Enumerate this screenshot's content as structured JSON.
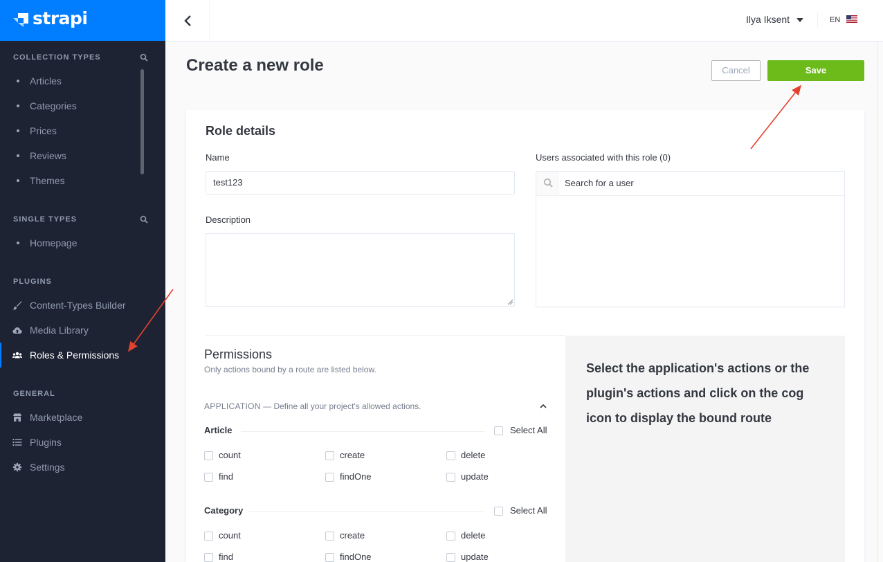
{
  "brand": {
    "name": "strapi"
  },
  "sidebar": {
    "collection_types": {
      "title": "COLLECTION TYPES",
      "items": [
        {
          "label": "Articles"
        },
        {
          "label": "Categories"
        },
        {
          "label": "Prices"
        },
        {
          "label": "Reviews"
        },
        {
          "label": "Themes"
        }
      ]
    },
    "single_types": {
      "title": "SINGLE TYPES",
      "items": [
        {
          "label": "Homepage"
        }
      ]
    },
    "plugins": {
      "title": "PLUGINS",
      "items": [
        {
          "label": "Content-Types Builder",
          "icon": "paintbrush-icon"
        },
        {
          "label": "Media Library",
          "icon": "cloud-upload-icon"
        },
        {
          "label": "Roles & Permissions",
          "icon": "users-icon",
          "active": true
        }
      ]
    },
    "general": {
      "title": "GENERAL",
      "items": [
        {
          "label": "Marketplace",
          "icon": "store-icon"
        },
        {
          "label": "Plugins",
          "icon": "list-icon"
        },
        {
          "label": "Settings",
          "icon": "gear-icon"
        }
      ]
    }
  },
  "header": {
    "user_name": "Ilya Iksent",
    "language": "EN"
  },
  "page": {
    "title": "Create a new role",
    "cancel_label": "Cancel",
    "save_label": "Save"
  },
  "role_details": {
    "title": "Role details",
    "name_label": "Name",
    "name_value": "test123",
    "description_label": "Description",
    "users_label": "Users associated with this role (0)",
    "users_search_placeholder": "Search for a user"
  },
  "permissions": {
    "title": "Permissions",
    "subtitle": "Only actions bound by a route are listed below.",
    "application_label": "APPLICATION",
    "application_desc": "— Define all your project's allowed actions.",
    "select_all_label": "Select All",
    "groups": [
      {
        "name": "Article",
        "actions": [
          "count",
          "create",
          "delete",
          "find",
          "findOne",
          "update"
        ]
      },
      {
        "name": "Category",
        "actions": [
          "count",
          "create",
          "delete",
          "find",
          "findOne",
          "update"
        ]
      }
    ],
    "help_text": "Select the application's actions or the plugin's actions and click on the cog icon to display the bound route"
  },
  "colors": {
    "sidebar_bg": "#1d2333",
    "brand_blue": "#007eff",
    "save_green": "#6dbb1a",
    "annotation_red": "#e5412f"
  }
}
